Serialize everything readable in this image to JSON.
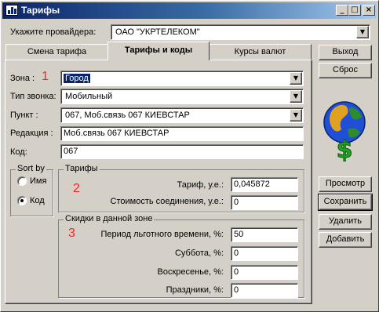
{
  "window": {
    "title": "Тарифы",
    "min_glyph": "_",
    "max_glyph": "□",
    "close_glyph": "×"
  },
  "provider": {
    "label": "Укажите провайдера:",
    "value": "ОАО \"УКРТЕЛЕКОМ\""
  },
  "tabs": [
    {
      "label": "Смена тарифа"
    },
    {
      "label": "Тарифы и коды",
      "active": true
    },
    {
      "label": "Курсы валют"
    }
  ],
  "form": {
    "zone": {
      "label": "Зона :",
      "value": "Город"
    },
    "call_type": {
      "label": "Тип звонка:",
      "value": "Мобильный"
    },
    "point": {
      "label": "Пункт :",
      "value": "067, Моб.связь 067 КИЕВСТАР"
    },
    "edition": {
      "label": "Редакция :",
      "value": "Моб.связь 067 КИЕВСТАР"
    },
    "code": {
      "label": "Код:",
      "value": "067"
    }
  },
  "sort_by": {
    "title": "Sort by",
    "options": [
      {
        "label": "Имя",
        "checked": false
      },
      {
        "label": "Код",
        "checked": true
      }
    ]
  },
  "tariffs": {
    "title": "Тарифы",
    "tariff": {
      "label": "Тариф, у.е.:",
      "value": "0,045872"
    },
    "connection_cost": {
      "label": "Стоимость соединения, у.е.:",
      "value": "0"
    }
  },
  "discounts": {
    "title": "Скидки в данной зоне",
    "grace_period": {
      "label": "Период льготного времени, %:",
      "value": "50"
    },
    "saturday": {
      "label": "Суббота, %:",
      "value": "0"
    },
    "sunday": {
      "label": "Воскресенье, %:",
      "value": "0"
    },
    "holidays": {
      "label": "Праздники, %:",
      "value": "0"
    }
  },
  "annotations": [
    "1",
    "2",
    "3"
  ],
  "buttons": {
    "exit": "Выход",
    "reset": "Сброс",
    "preview": "Просмотр",
    "save": "Сохранить",
    "delete": "Удалить",
    "add": "Добавить"
  },
  "icons": {
    "app": "chart-icon",
    "logo": "globe-dollar-icon",
    "dropdown": "chevron-down-icon"
  },
  "colors": {
    "face": "#d4d0c8",
    "title_start": "#0a246a",
    "title_end": "#a6caf0",
    "selection": "#0a246a",
    "annotation": "#ff2020"
  }
}
